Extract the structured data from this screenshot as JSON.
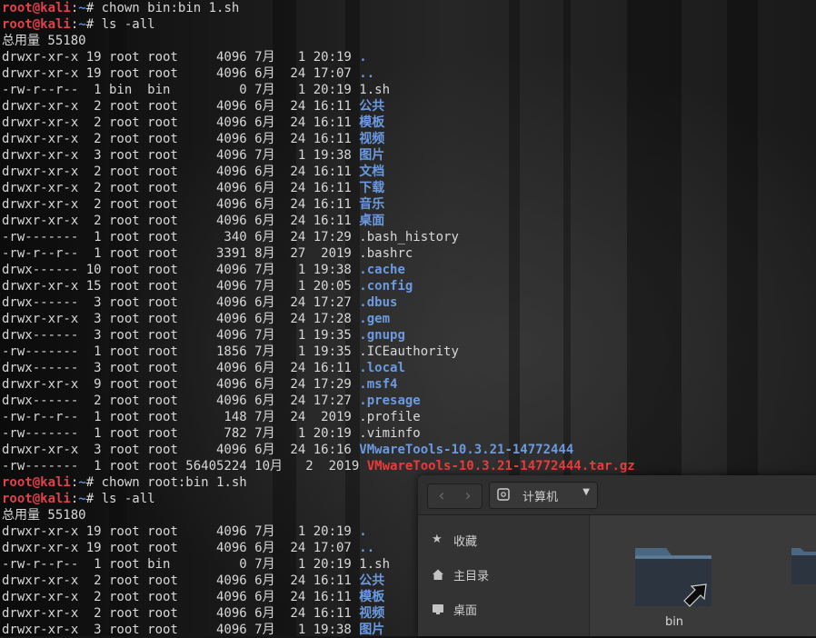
{
  "terminal": {
    "prompt": {
      "user": "root@kali",
      "sep": ":",
      "dir": "~",
      "hash": "# "
    },
    "lines": [
      {
        "type": "cmd",
        "cmd": "chown bin:bin 1.sh"
      },
      {
        "type": "cmd",
        "cmd": "ls -all"
      },
      {
        "type": "text",
        "text": "总用量 55180"
      },
      {
        "type": "entry",
        "meta": "drwxr-xr-x 19 root root     4096 7月   1 20:19 ",
        "name": ".",
        "kind": "dir"
      },
      {
        "type": "entry",
        "meta": "drwxr-xr-x 19 root root     4096 6月  24 17:07 ",
        "name": "..",
        "kind": "dir"
      },
      {
        "type": "entry",
        "meta": "-rw-r--r--  1 bin  bin         0 7月   1 20:19 ",
        "name": "1.sh",
        "kind": "plain"
      },
      {
        "type": "entry",
        "meta": "drwxr-xr-x  2 root root     4096 6月  24 16:11 ",
        "name": "公共",
        "kind": "dir"
      },
      {
        "type": "entry",
        "meta": "drwxr-xr-x  2 root root     4096 6月  24 16:11 ",
        "name": "模板",
        "kind": "dir"
      },
      {
        "type": "entry",
        "meta": "drwxr-xr-x  2 root root     4096 6月  24 16:11 ",
        "name": "视频",
        "kind": "dir"
      },
      {
        "type": "entry",
        "meta": "drwxr-xr-x  3 root root     4096 7月   1 19:38 ",
        "name": "图片",
        "kind": "dir"
      },
      {
        "type": "entry",
        "meta": "drwxr-xr-x  2 root root     4096 6月  24 16:11 ",
        "name": "文档",
        "kind": "dir"
      },
      {
        "type": "entry",
        "meta": "drwxr-xr-x  2 root root     4096 6月  24 16:11 ",
        "name": "下载",
        "kind": "dir"
      },
      {
        "type": "entry",
        "meta": "drwxr-xr-x  2 root root     4096 6月  24 16:11 ",
        "name": "音乐",
        "kind": "dir"
      },
      {
        "type": "entry",
        "meta": "drwxr-xr-x  2 root root     4096 6月  24 16:11 ",
        "name": "桌面",
        "kind": "dir"
      },
      {
        "type": "entry",
        "meta": "-rw-------  1 root root      340 6月  24 17:29 ",
        "name": ".bash_history",
        "kind": "plain"
      },
      {
        "type": "entry",
        "meta": "-rw-r--r--  1 root root     3391 8月  27  2019 ",
        "name": ".bashrc",
        "kind": "plain"
      },
      {
        "type": "entry",
        "meta": "drwx------ 10 root root     4096 7月   1 19:38 ",
        "name": ".cache",
        "kind": "dir"
      },
      {
        "type": "entry",
        "meta": "drwxr-xr-x 15 root root     4096 7月   1 20:05 ",
        "name": ".config",
        "kind": "dir"
      },
      {
        "type": "entry",
        "meta": "drwx------  3 root root     4096 6月  24 17:27 ",
        "name": ".dbus",
        "kind": "dir"
      },
      {
        "type": "entry",
        "meta": "drwxr-xr-x  3 root root     4096 6月  24 17:28 ",
        "name": ".gem",
        "kind": "dir"
      },
      {
        "type": "entry",
        "meta": "drwx------  3 root root     4096 7月   1 19:35 ",
        "name": ".gnupg",
        "kind": "dir"
      },
      {
        "type": "entry",
        "meta": "-rw-------  1 root root     1856 7月   1 19:35 ",
        "name": ".ICEauthority",
        "kind": "plain"
      },
      {
        "type": "entry",
        "meta": "drwx------  3 root root     4096 6月  24 16:11 ",
        "name": ".local",
        "kind": "dir"
      },
      {
        "type": "entry",
        "meta": "drwxr-xr-x  9 root root     4096 6月  24 17:29 ",
        "name": ".msf4",
        "kind": "dir"
      },
      {
        "type": "entry",
        "meta": "drwx------  2 root root     4096 6月  24 17:27 ",
        "name": ".presage",
        "kind": "dir"
      },
      {
        "type": "entry",
        "meta": "-rw-r--r--  1 root root      148 7月  24  2019 ",
        "name": ".profile",
        "kind": "plain"
      },
      {
        "type": "entry",
        "meta": "-rw-------  1 root root      782 7月   1 20:19 ",
        "name": ".viminfo",
        "kind": "plain"
      },
      {
        "type": "entry",
        "meta": "drwxr-xr-x  3 root root     4096 6月  24 16:16 ",
        "name": "VMwareTools-10.3.21-14772444",
        "kind": "dir"
      },
      {
        "type": "entry",
        "meta": "-rw-------  1 root root 56405224 10月   2  2019 ",
        "name": "VMwareTools-10.3.21-14772444.tar.gz",
        "kind": "archive"
      },
      {
        "type": "cmd",
        "cmd": "chown root:bin 1.sh"
      },
      {
        "type": "cmd",
        "cmd": "ls -all"
      },
      {
        "type": "text",
        "text": "总用量 55180"
      },
      {
        "type": "entry",
        "meta": "drwxr-xr-x 19 root root     4096 7月   1 20:19 ",
        "name": ".",
        "kind": "dir"
      },
      {
        "type": "entry",
        "meta": "drwxr-xr-x 19 root root     4096 6月  24 17:07 ",
        "name": "..",
        "kind": "dir"
      },
      {
        "type": "entry",
        "meta": "-rw-r--r--  1 root bin         0 7月   1 20:19 ",
        "name": "1.sh",
        "kind": "plain"
      },
      {
        "type": "entry",
        "meta": "drwxr-xr-x  2 root root     4096 6月  24 16:11 ",
        "name": "公共",
        "kind": "dir"
      },
      {
        "type": "entry",
        "meta": "drwxr-xr-x  2 root root     4096 6月  24 16:11 ",
        "name": "模板",
        "kind": "dir"
      },
      {
        "type": "entry",
        "meta": "drwxr-xr-x  2 root root     4096 6月  24 16:11 ",
        "name": "视频",
        "kind": "dir"
      },
      {
        "type": "entry",
        "meta": "drwxr-xr-x  3 root root     4096 7月   1 19:38 ",
        "name": "图片",
        "kind": "dir"
      }
    ]
  },
  "file_manager": {
    "location": "计算机",
    "sidebar": [
      {
        "label": "收藏",
        "icon": "star-icon"
      },
      {
        "label": "主目录",
        "icon": "home-icon"
      },
      {
        "label": "桌面",
        "icon": "desktop-icon"
      }
    ],
    "folders": [
      {
        "label": "bin",
        "icon": "folder-link-icon"
      }
    ]
  },
  "colors": {
    "prompt_user": "#e0414a",
    "prompt_dir": "#5b8fd6",
    "dir_entry": "#6b9ae0",
    "archive_entry": "#ec3b3b",
    "terminal_text": "#d8d8d8"
  }
}
